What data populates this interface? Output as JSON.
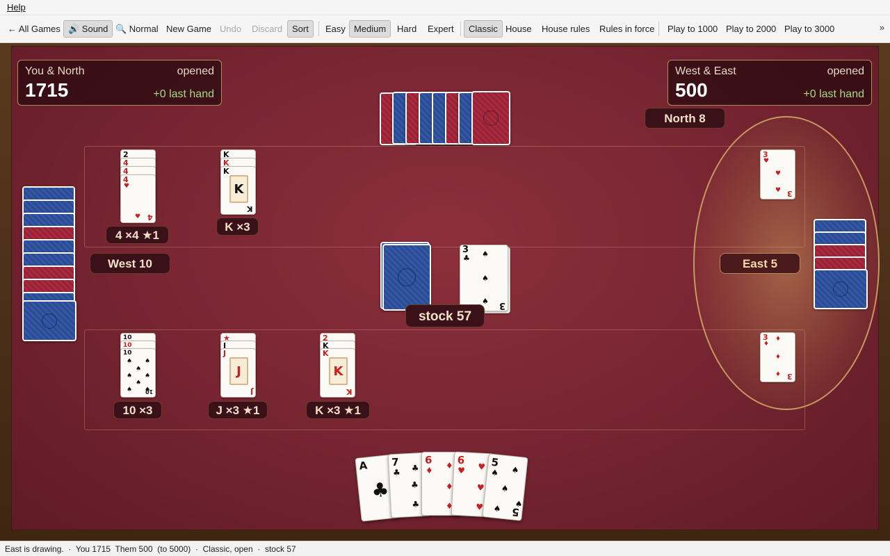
{
  "menu": {
    "help": "Help"
  },
  "toolbar": {
    "all_games": "← All Games",
    "sound": "🔊 Sound",
    "normal": "🔍 Normal",
    "new_game": "New Game",
    "undo": "Undo",
    "discard": "Discard",
    "sort": "Sort",
    "easy": "Easy",
    "medium": "Medium",
    "hard": "Hard",
    "expert": "Expert",
    "classic": "Classic",
    "house": "House",
    "house_rules": "House rules",
    "rules_in_force": "Rules in force",
    "play_1000": "Play to 1000",
    "play_2000": "Play to 2000",
    "play_3000": "Play to 3000",
    "more": "»"
  },
  "scores": {
    "us": {
      "team": "You & North",
      "status": "opened",
      "points": "1715",
      "last": "+0 last hand"
    },
    "them": {
      "team": "West & East",
      "status": "opened",
      "points": "500",
      "last": "+0 last hand"
    }
  },
  "players": {
    "north": "North  8",
    "west": "West  10",
    "east": "East  5"
  },
  "table": {
    "stock_label": "stock 57",
    "discard_top": {
      "rank": "3",
      "suit": "♣"
    }
  },
  "melds": {
    "them": [
      {
        "label": "4 ×4 ★1",
        "ranks": [
          "2",
          "4",
          "4",
          "4"
        ]
      },
      {
        "label": "K ×3",
        "ranks": [
          "K",
          "K",
          "K"
        ]
      }
    ],
    "us": [
      {
        "label": "10 ×3",
        "ranks": [
          "10",
          "10",
          "10"
        ]
      },
      {
        "label": "J ×3 ★1",
        "ranks": [
          "★",
          "J",
          "J"
        ]
      },
      {
        "label": "K ×3 ★1",
        "ranks": [
          "2",
          "K",
          "K"
        ]
      }
    ],
    "east_red_threes": [
      {
        "rank": "3",
        "suit": "♥"
      },
      {
        "rank": "3",
        "suit": "♦"
      }
    ]
  },
  "hand": [
    {
      "rank": "A",
      "suit": "♣",
      "color": "black"
    },
    {
      "rank": "7",
      "suit": "♣",
      "color": "black"
    },
    {
      "rank": "6",
      "suit": "♦",
      "color": "red"
    },
    {
      "rank": "6",
      "suit": "♥",
      "color": "red"
    },
    {
      "rank": "5",
      "suit": "♠",
      "color": "black"
    }
  ],
  "statusbar": "East is drawing.  ·  You 1715  Them 500  (to 5000)  ·  Classic, open  ·  stock 57"
}
